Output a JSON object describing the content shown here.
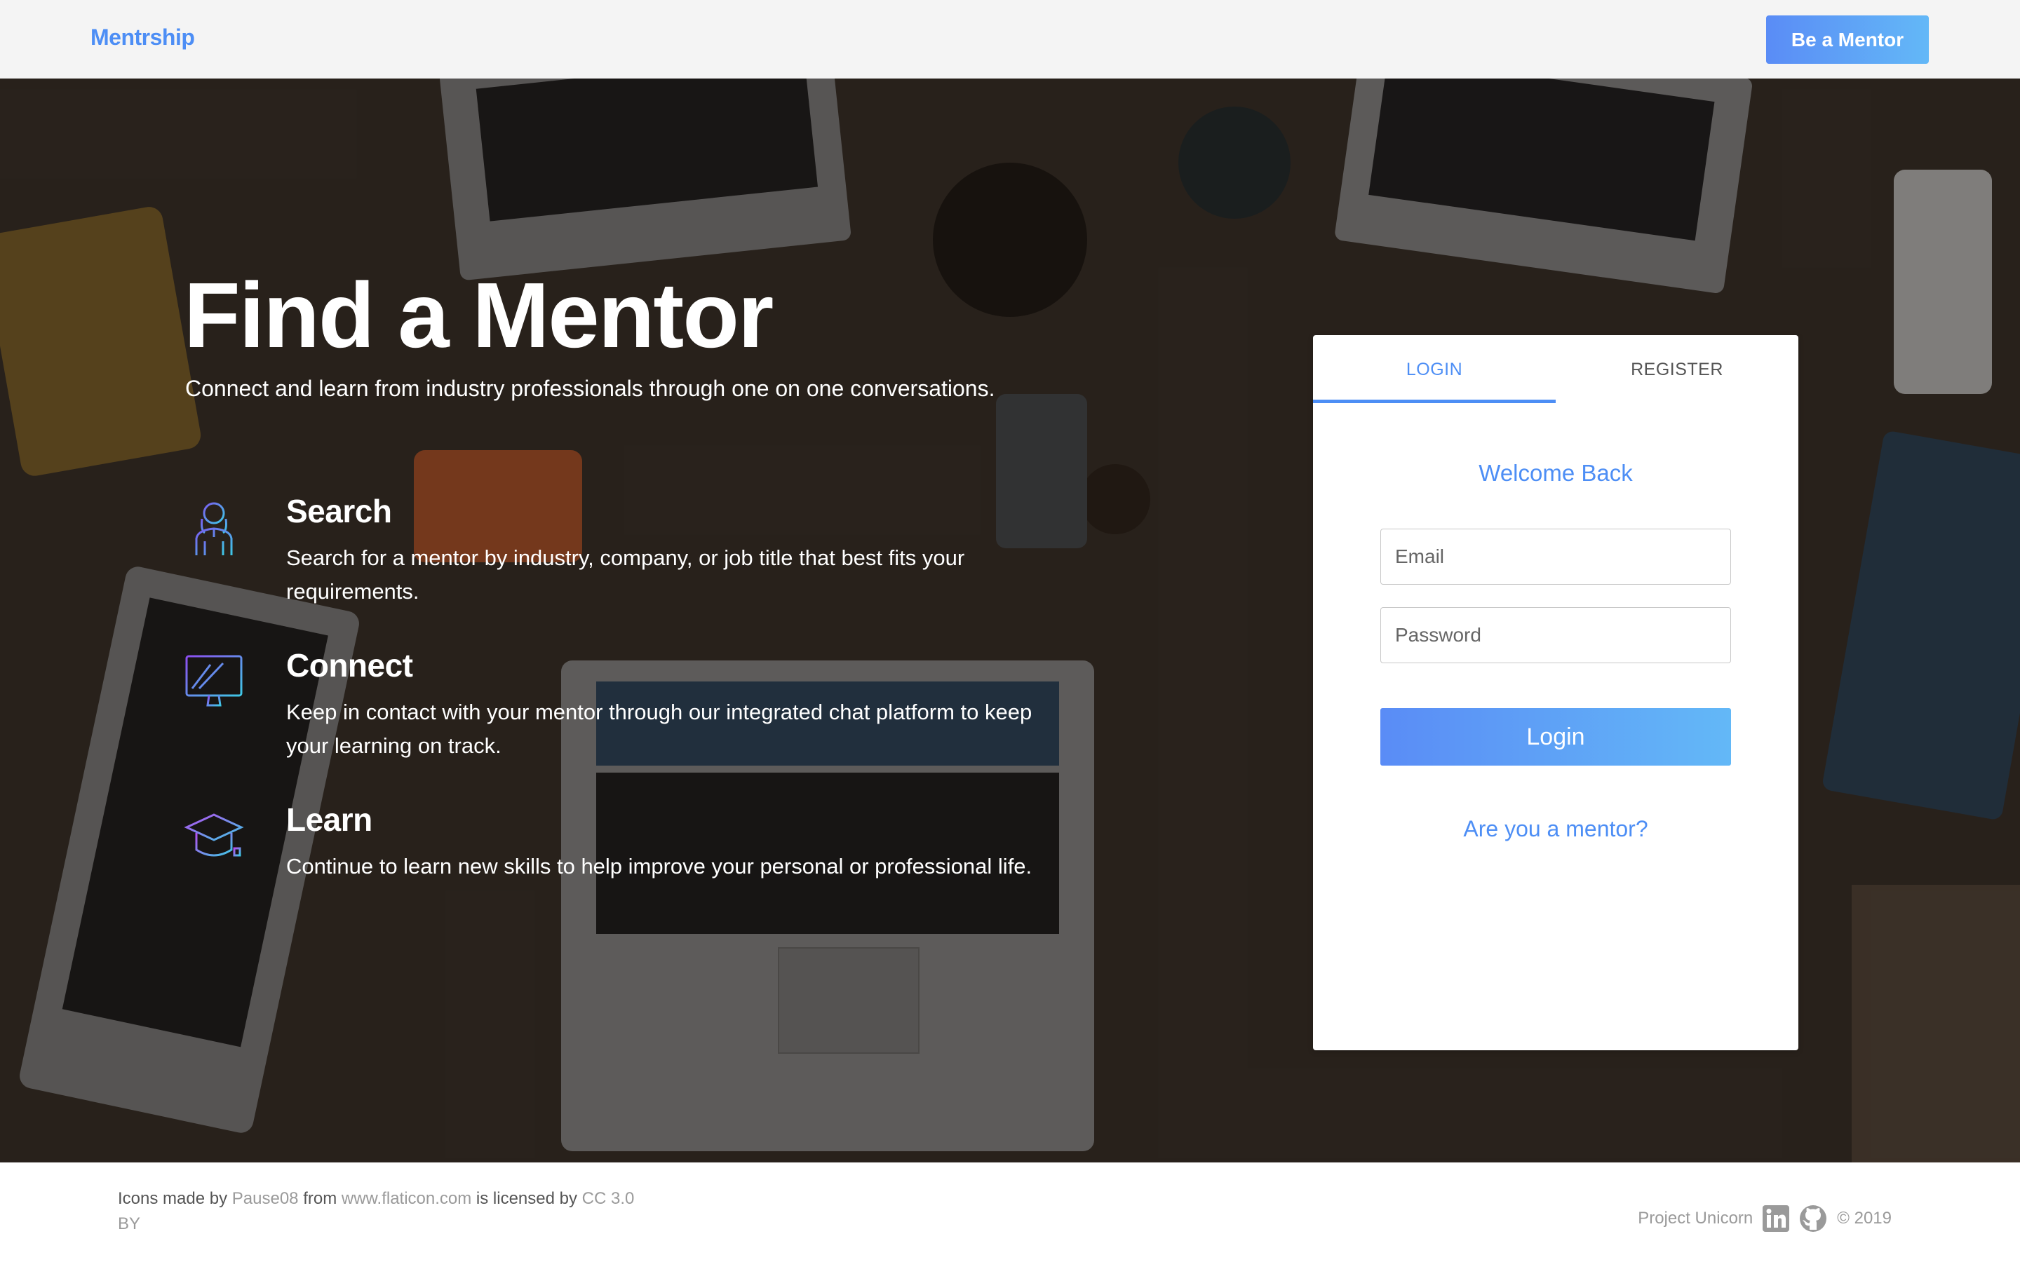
{
  "navbar": {
    "brand": "Mentrship",
    "cta_label": "Be a Mentor"
  },
  "hero": {
    "title": "Find a Mentor",
    "subtitle": "Connect and learn from industry professionals through one on one conversations.",
    "features": [
      {
        "icon": "person-search-icon",
        "title": "Search",
        "text": "Search for a mentor by industry, company, or job title that best fits your requirements."
      },
      {
        "icon": "monitor-chat-icon",
        "title": "Connect",
        "text": "Keep in contact with your mentor through our integrated chat platform to keep your learning on track."
      },
      {
        "icon": "graduation-cap-icon",
        "title": "Learn",
        "text": "Continue to learn new skills to help improve your personal or professional life."
      }
    ]
  },
  "auth": {
    "tabs": [
      {
        "label": "LOGIN",
        "active": true
      },
      {
        "label": "REGISTER",
        "active": false
      }
    ],
    "welcome": "Welcome Back",
    "email_placeholder": "Email",
    "password_placeholder": "Password",
    "submit_label": "Login",
    "mentor_link": "Are you a mentor?"
  },
  "footer": {
    "credit_prefix": "Icons made by",
    "credit_author": "Pause08",
    "credit_from": "from",
    "credit_site": "www.flaticon.com",
    "credit_licensed": "is licensed by",
    "credit_license": "CC 3.0 BY",
    "project": "Project Unicorn",
    "copyright": "© 2019",
    "icons": [
      "linkedin-icon",
      "github-icon"
    ]
  },
  "colors": {
    "accent": "#4d8ef5",
    "button_gradient_start": "#5a8cf6",
    "button_gradient_end": "#63b8f7",
    "navbar_bg": "#f4f4f4"
  }
}
